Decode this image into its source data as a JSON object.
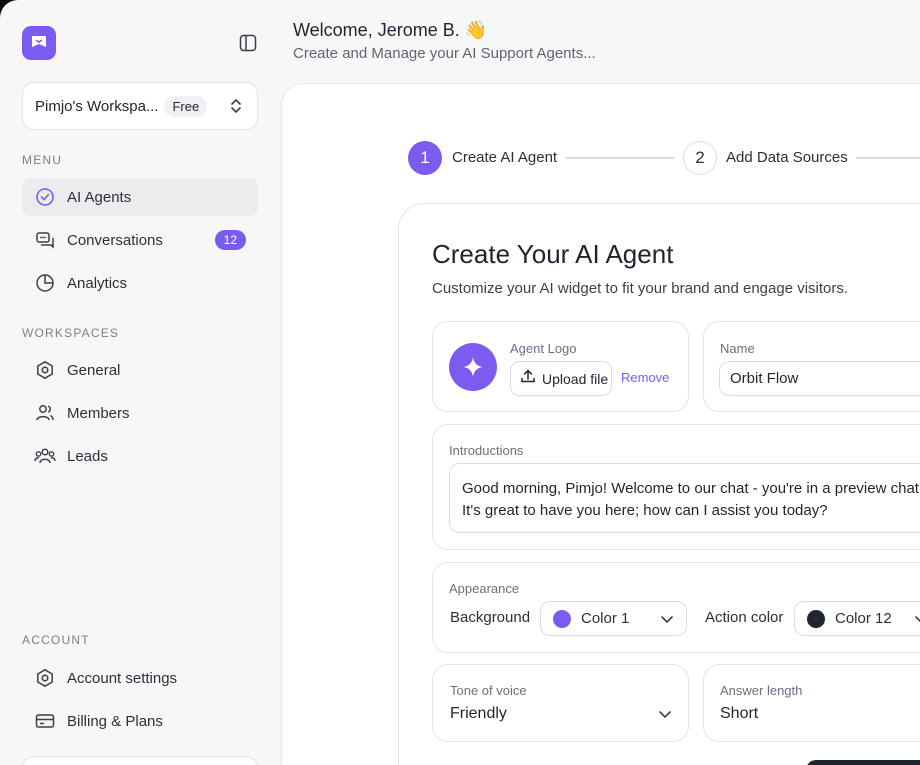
{
  "header": {
    "welcome": "Welcome, Jerome B. 👋",
    "subtitle": "Create and Manage your AI Support Agents..."
  },
  "workspace": {
    "name": "Pimjo's Workspa...",
    "badge": "Free"
  },
  "menu": {
    "section_label": "MENU",
    "items": [
      {
        "label": "AI Agents",
        "icon": "check-circle-icon",
        "active": true
      },
      {
        "label": "Conversations",
        "icon": "chat-bubbles-icon",
        "count": "12"
      },
      {
        "label": "Analytics",
        "icon": "pie-chart-icon"
      }
    ]
  },
  "workspaces": {
    "section_label": "WORKSPACES",
    "items": [
      {
        "label": "General",
        "icon": "hexagon-settings-icon"
      },
      {
        "label": "Members",
        "icon": "users-icon"
      },
      {
        "label": "Leads",
        "icon": "group-icon"
      }
    ]
  },
  "account": {
    "section_label": "ACCOUNT",
    "items": [
      {
        "label": "Account settings",
        "icon": "hexagon-settings-icon"
      },
      {
        "label": "Billing & Plans",
        "icon": "credit-card-icon"
      }
    ]
  },
  "steps": [
    {
      "number": "1",
      "label": "Create AI Agent",
      "active": true
    },
    {
      "number": "2",
      "label": "Add Data Sources",
      "active": false
    }
  ],
  "form": {
    "title": "Create Your AI Agent",
    "description": "Customize your AI widget to fit your brand and engage visitors.",
    "agent_logo": {
      "label": "Agent Logo",
      "upload_label": "Upload file",
      "remove_label": "Remove"
    },
    "name": {
      "label": "Name",
      "value": "Orbit Flow"
    },
    "introductions": {
      "label": "Introductions",
      "value": "Good morning, Pimjo! Welcome to our chat - you're in a preview chat.\nIt's great to have you here; how can I assist you today?"
    },
    "appearance": {
      "label": "Appearance",
      "background_label": "Background",
      "background_value": "Color 1",
      "background_color": "#7c5cf0",
      "action_label": "Action color",
      "action_value": "Color 12",
      "action_color": "#1f2430"
    },
    "tone": {
      "label": "Tone of voice",
      "value": "Friendly"
    },
    "answer_length": {
      "label": "Answer length",
      "value": "Short"
    }
  },
  "colors": {
    "accent": "#7c5cf0",
    "text": "#1f2430",
    "muted": "#6b7080"
  }
}
